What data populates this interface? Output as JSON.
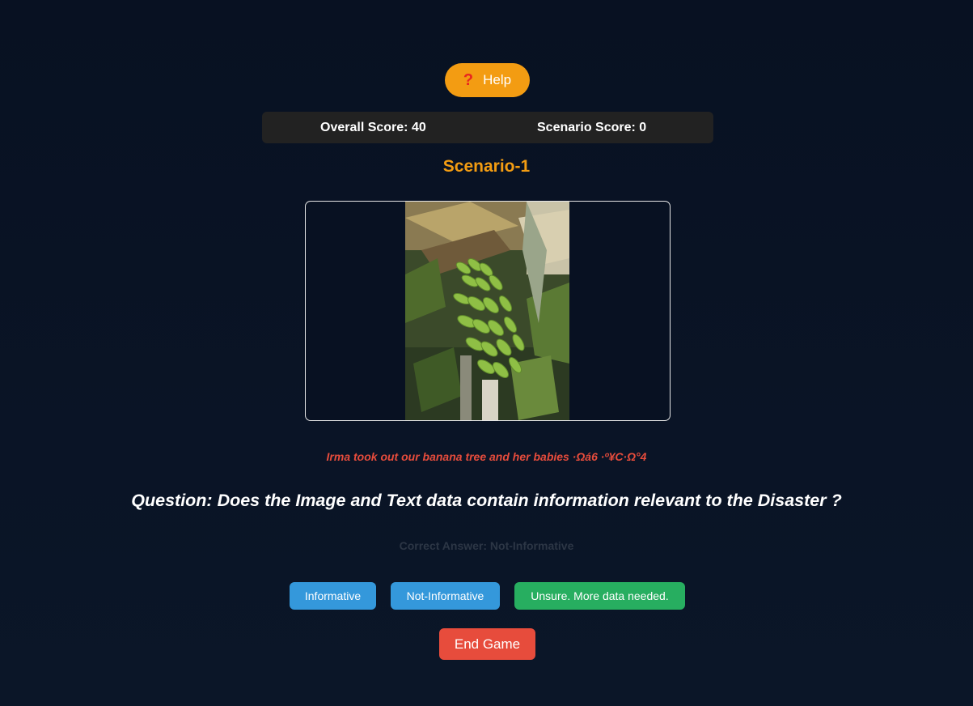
{
  "help": {
    "icon": "question-mark-icon",
    "label": "Help"
  },
  "scores": {
    "overall": "Overall Score: 40",
    "scenario": "Scenario Score: 0"
  },
  "scenario": {
    "title": "Scenario-1"
  },
  "tweet": {
    "text": "Irma took out our banana tree and her babies ·Ωá6 ·º¥C·Ω°4"
  },
  "question": {
    "text": "Question: Does the Image and Text data contain information relevant to the Disaster ?"
  },
  "answer": {
    "text": "Correct Answer: Not-Informative"
  },
  "choices": {
    "informative": "Informative",
    "not_informative": "Not-Informative",
    "unsure": "Unsure. More data needed."
  },
  "end_game": {
    "label": "End Game"
  },
  "colors": {
    "accent": "#f39c12",
    "primary_button": "#3498db",
    "success_button": "#27ae60",
    "danger": "#e74c3c",
    "background": "#081122"
  }
}
